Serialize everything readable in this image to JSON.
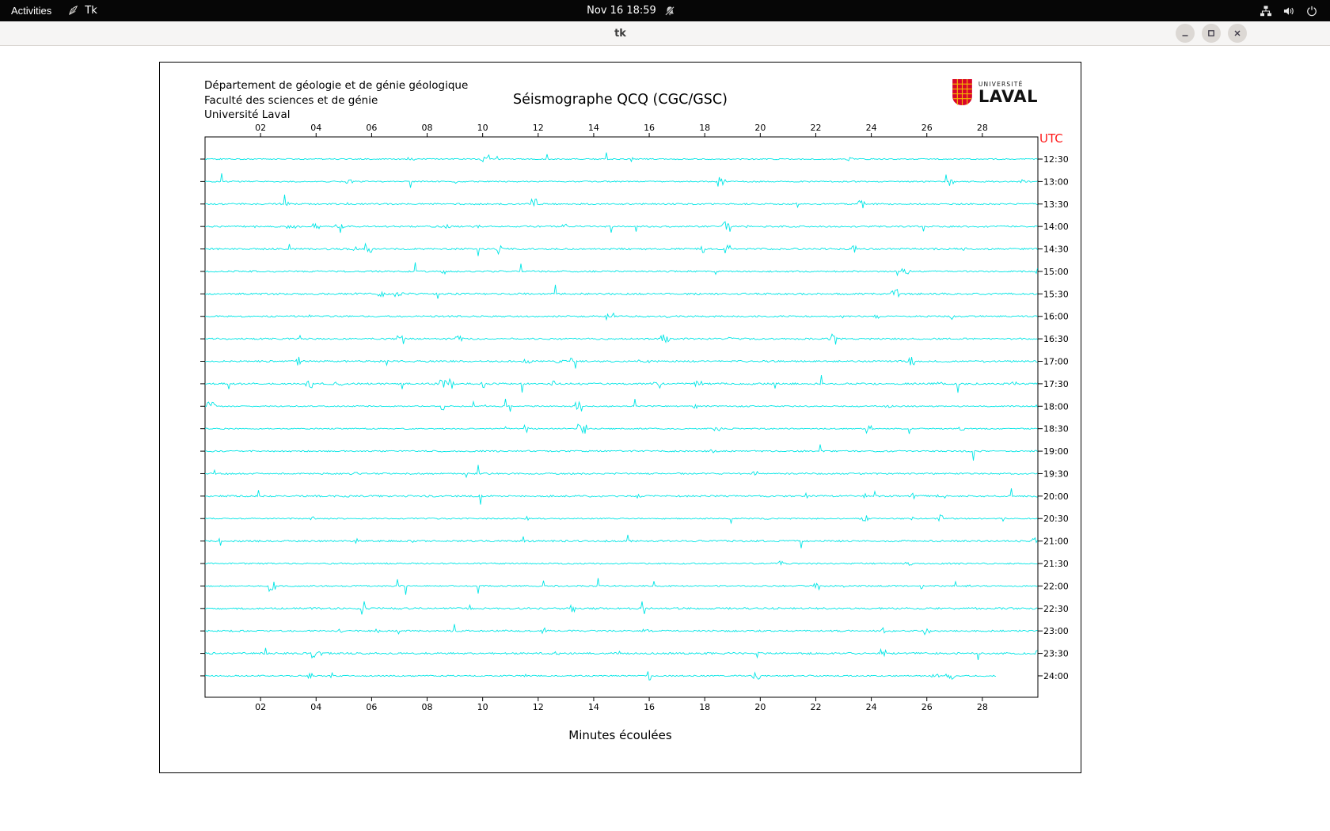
{
  "top_bar": {
    "activities_label": "Activities",
    "app_name": "Tk",
    "clock": "Nov 16 18:59",
    "icons": [
      "tk-app-icon",
      "notifications-muted-icon",
      "network-icon",
      "volume-icon",
      "power-icon"
    ]
  },
  "window": {
    "title": "tk",
    "controls": [
      "minimize",
      "maximize",
      "close"
    ]
  },
  "seismograph": {
    "institution_lines": [
      "Département de géologie et de génie géologique",
      "Faculté des sciences et de génie",
      "Université Laval"
    ],
    "title": "Séismographe QCQ (CGC/GSC)",
    "utc_label": "UTC",
    "utc_color": "#ff1a1a",
    "x_axis_label": "Minutes écoulées",
    "x_ticks": [
      "02",
      "04",
      "06",
      "08",
      "10",
      "12",
      "14",
      "16",
      "18",
      "20",
      "22",
      "24",
      "26",
      "28"
    ],
    "x_range_minutes": [
      0,
      30
    ],
    "time_labels": [
      "12:30",
      "13:00",
      "13:30",
      "14:00",
      "14:30",
      "15:00",
      "15:30",
      "16:00",
      "16:30",
      "17:00",
      "17:30",
      "18:00",
      "18:30",
      "19:00",
      "19:30",
      "20:00",
      "20:30",
      "21:00",
      "21:30",
      "22:00",
      "22:30",
      "23:00",
      "23:30",
      "24:00"
    ],
    "trace_color": "#00e5e5",
    "logo": {
      "top_text": "UNIVERSITÉ",
      "bottom_text": "LAVAL"
    }
  }
}
